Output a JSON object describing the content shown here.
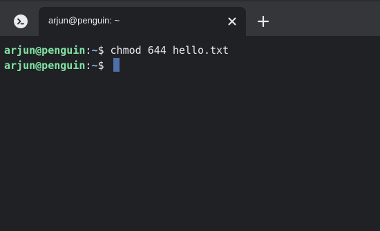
{
  "tab": {
    "title": "arjun@penguin: ~",
    "app_icon": "terminal-icon",
    "close_icon": "close-icon",
    "new_tab_icon": "plus-icon"
  },
  "terminal": {
    "lines": [
      {
        "user": "arjun@penguin",
        "sep": ":",
        "path": "~",
        "prompt": "$ ",
        "command": "chmod 644 hello.txt"
      },
      {
        "user": "arjun@penguin",
        "sep": ":",
        "path": "~",
        "prompt": "$ ",
        "command": ""
      }
    ]
  },
  "colors": {
    "background": "#202124",
    "tabstrip": "#35363a",
    "user": "#81e2a4",
    "path": "#8ab4f8",
    "cursor": "#4f6fa8"
  }
}
